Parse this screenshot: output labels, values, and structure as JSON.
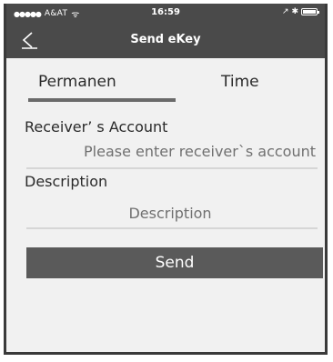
{
  "status_bar": {
    "signal": "●●●●●",
    "carrier": "A&AT",
    "wifi": "ᯤ",
    "time": "16:59",
    "right": "↗ ✱"
  },
  "nav": {
    "title": "Send eKey",
    "back_icon": "back-chevron-icon"
  },
  "tabs": [
    {
      "label": "Permanen",
      "selected": true
    },
    {
      "label": "Time",
      "selected": false
    }
  ],
  "form": {
    "receiver_label": "Receiver’ s Account",
    "receiver_placeholder": "Please enter receiver`s account",
    "receiver_value": "",
    "description_label": "Description",
    "description_placeholder": "Description",
    "description_value": ""
  },
  "send_button": {
    "label": "Send"
  },
  "colors": {
    "header_bg": "#4a4a4a",
    "page_bg": "#f1f1f1",
    "button_bg": "#5a5a5a",
    "indicator": "#6a6a6a"
  }
}
